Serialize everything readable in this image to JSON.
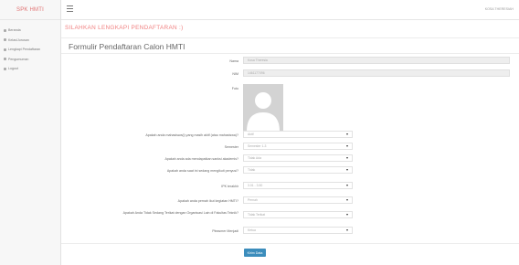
{
  "app": {
    "brand": "SPK HMTI"
  },
  "sidebar": {
    "items": [
      {
        "label": "Beranda",
        "icon": "home-icon"
      },
      {
        "label": "Kelas/Jurusan",
        "icon": "list-icon"
      },
      {
        "label": "Lengkapi Pendaftaran",
        "icon": "edit-icon"
      },
      {
        "label": "Pengumuman",
        "icon": "bell-icon"
      },
      {
        "label": "Logout",
        "icon": "logout-icon"
      }
    ]
  },
  "topbar": {
    "user": "KOSA THERESIAH"
  },
  "main": {
    "banner": "SILAHKAN LENGKAPI PENDAFTARAN :)",
    "form_title": "Formulir Pendaftaran Calon HMTI",
    "fields": {
      "nama": {
        "label": "Nama",
        "value": "Kosa Theresia"
      },
      "nim": {
        "label": "NIM",
        "value": "1461177096"
      },
      "foto": {
        "label": "Foto"
      }
    },
    "selects": [
      {
        "label": "Apakah anda mahasiswa(i) yang masih aktif (atau mahasiswa)?",
        "value": "Aktif"
      },
      {
        "label": "Semester",
        "value": "Semester 1-3"
      },
      {
        "label": "Apakah anda ada mendapatkan sanksi akademis?",
        "value": "Tidak Ada"
      },
      {
        "label": "Apakah anda saat ini sedang mengikuti penyusi?",
        "value": "Tidak"
      },
      {
        "label": "IPK terakhir",
        "value": "3.01 - 3.50"
      },
      {
        "label": "Apakah anda pernah ikut kegiatan HMTI?",
        "value": "Pernah"
      },
      {
        "label": "Apakah Anda Tidak Sedang Terikat dengan Organisasi Lain di Fakultas Teknik?",
        "value": "Tidak Terikat"
      },
      {
        "label": "Pleasmer Menjadi",
        "value": "Ketua"
      }
    ],
    "submit_label": "Kirim Data"
  },
  "colors": {
    "accent": "#3c8dbc",
    "brand": "#e07070",
    "banner": "#f08080"
  }
}
